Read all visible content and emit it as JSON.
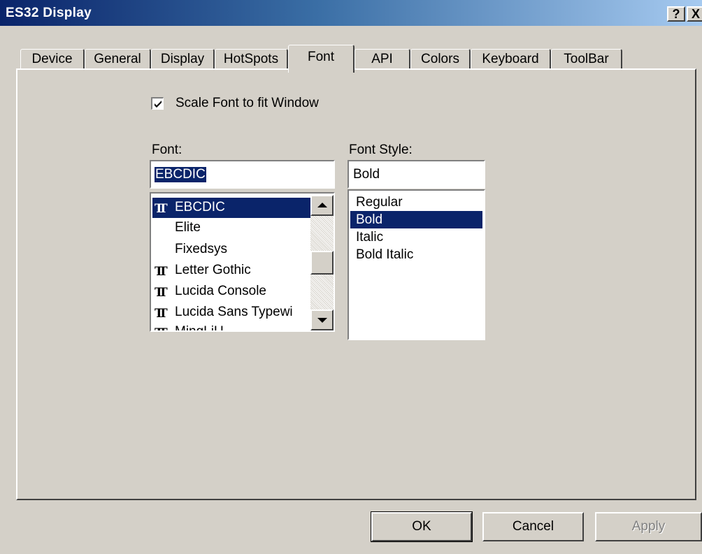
{
  "window": {
    "title": "ES32 Display",
    "help_label": "?",
    "close_label": "X"
  },
  "tabs": [
    {
      "label": "Device"
    },
    {
      "label": "General"
    },
    {
      "label": "Display"
    },
    {
      "label": "HotSpots"
    },
    {
      "label": "Font",
      "active": true
    },
    {
      "label": "API"
    },
    {
      "label": "Colors"
    },
    {
      "label": "Keyboard"
    },
    {
      "label": "ToolBar"
    }
  ],
  "scale_font": {
    "label": "Scale Font to fit Window",
    "checked": true
  },
  "font": {
    "label": "Font:",
    "value": "EBCDIC",
    "items": [
      {
        "name": "EBCDIC",
        "icon": "truetype-icon",
        "selected": true
      },
      {
        "name": "Elite",
        "icon": ""
      },
      {
        "name": "Fixedsys",
        "icon": ""
      },
      {
        "name": "Letter Gothic",
        "icon": "truetype-icon"
      },
      {
        "name": "Lucida Console",
        "icon": "truetype-icon"
      },
      {
        "name": "Lucida Sans Typewi",
        "icon": "truetype-icon"
      },
      {
        "name": "MingLiU",
        "icon": "truetype-icon"
      }
    ]
  },
  "font_style": {
    "label": "Font Style:",
    "value": "Bold",
    "items": [
      {
        "name": "Regular"
      },
      {
        "name": "Bold",
        "selected": true
      },
      {
        "name": "Italic"
      },
      {
        "name": "Bold Italic"
      }
    ]
  },
  "buttons": {
    "ok": "OK",
    "cancel": "Cancel",
    "apply": "Apply"
  },
  "colors": {
    "selection": "#0a246a",
    "face": "#d4d0c8"
  }
}
